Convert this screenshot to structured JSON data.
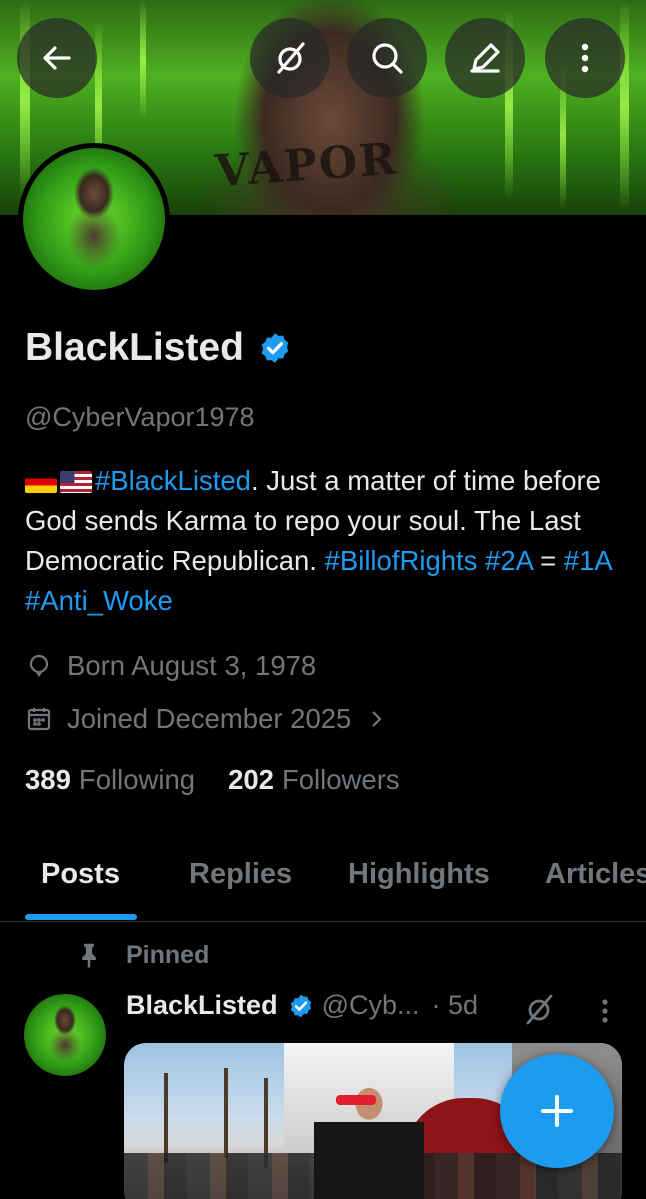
{
  "header": {
    "banner_tattoo_text": "VAPOR",
    "buttons": [
      {
        "name": "back-button",
        "icon": "arrow-left-icon"
      },
      {
        "name": "grok-button",
        "icon": "grok-icon"
      },
      {
        "name": "search-button",
        "icon": "search-icon"
      },
      {
        "name": "edit-button",
        "icon": "pencil-icon"
      },
      {
        "name": "more-button",
        "icon": "more-vertical-icon"
      }
    ]
  },
  "profile": {
    "display_name": "BlackListed",
    "handle": "@CyberVapor1978",
    "verified": true,
    "bio": {
      "tag1": "#BlackListed",
      "text1": ". Just a matter of time before God sends Karma to repo your soul. The Last Democratic Republican.",
      "tag2": "#BillofRights",
      "tag3": "#2A",
      "equals": " = ",
      "tag4": "#1A",
      "tag5": "#Anti_Woke"
    },
    "born": "Born August 3, 1978",
    "joined": "Joined December 2025",
    "following_count": "389",
    "following_label": "Following",
    "followers_count": "202",
    "followers_label": "Followers"
  },
  "tabs": [
    {
      "label": "Posts",
      "active": true
    },
    {
      "label": "Replies",
      "active": false
    },
    {
      "label": "Highlights",
      "active": false
    },
    {
      "label": "Articles",
      "active": false
    }
  ],
  "post": {
    "pinned_label": "Pinned",
    "author": "BlackListed",
    "handle": "@Cyb...",
    "time": "· 5d"
  },
  "colors": {
    "accent": "#1d9bf0",
    "background": "#000000",
    "muted_text": "#71767b",
    "primary_text": "#e7e9ea"
  }
}
